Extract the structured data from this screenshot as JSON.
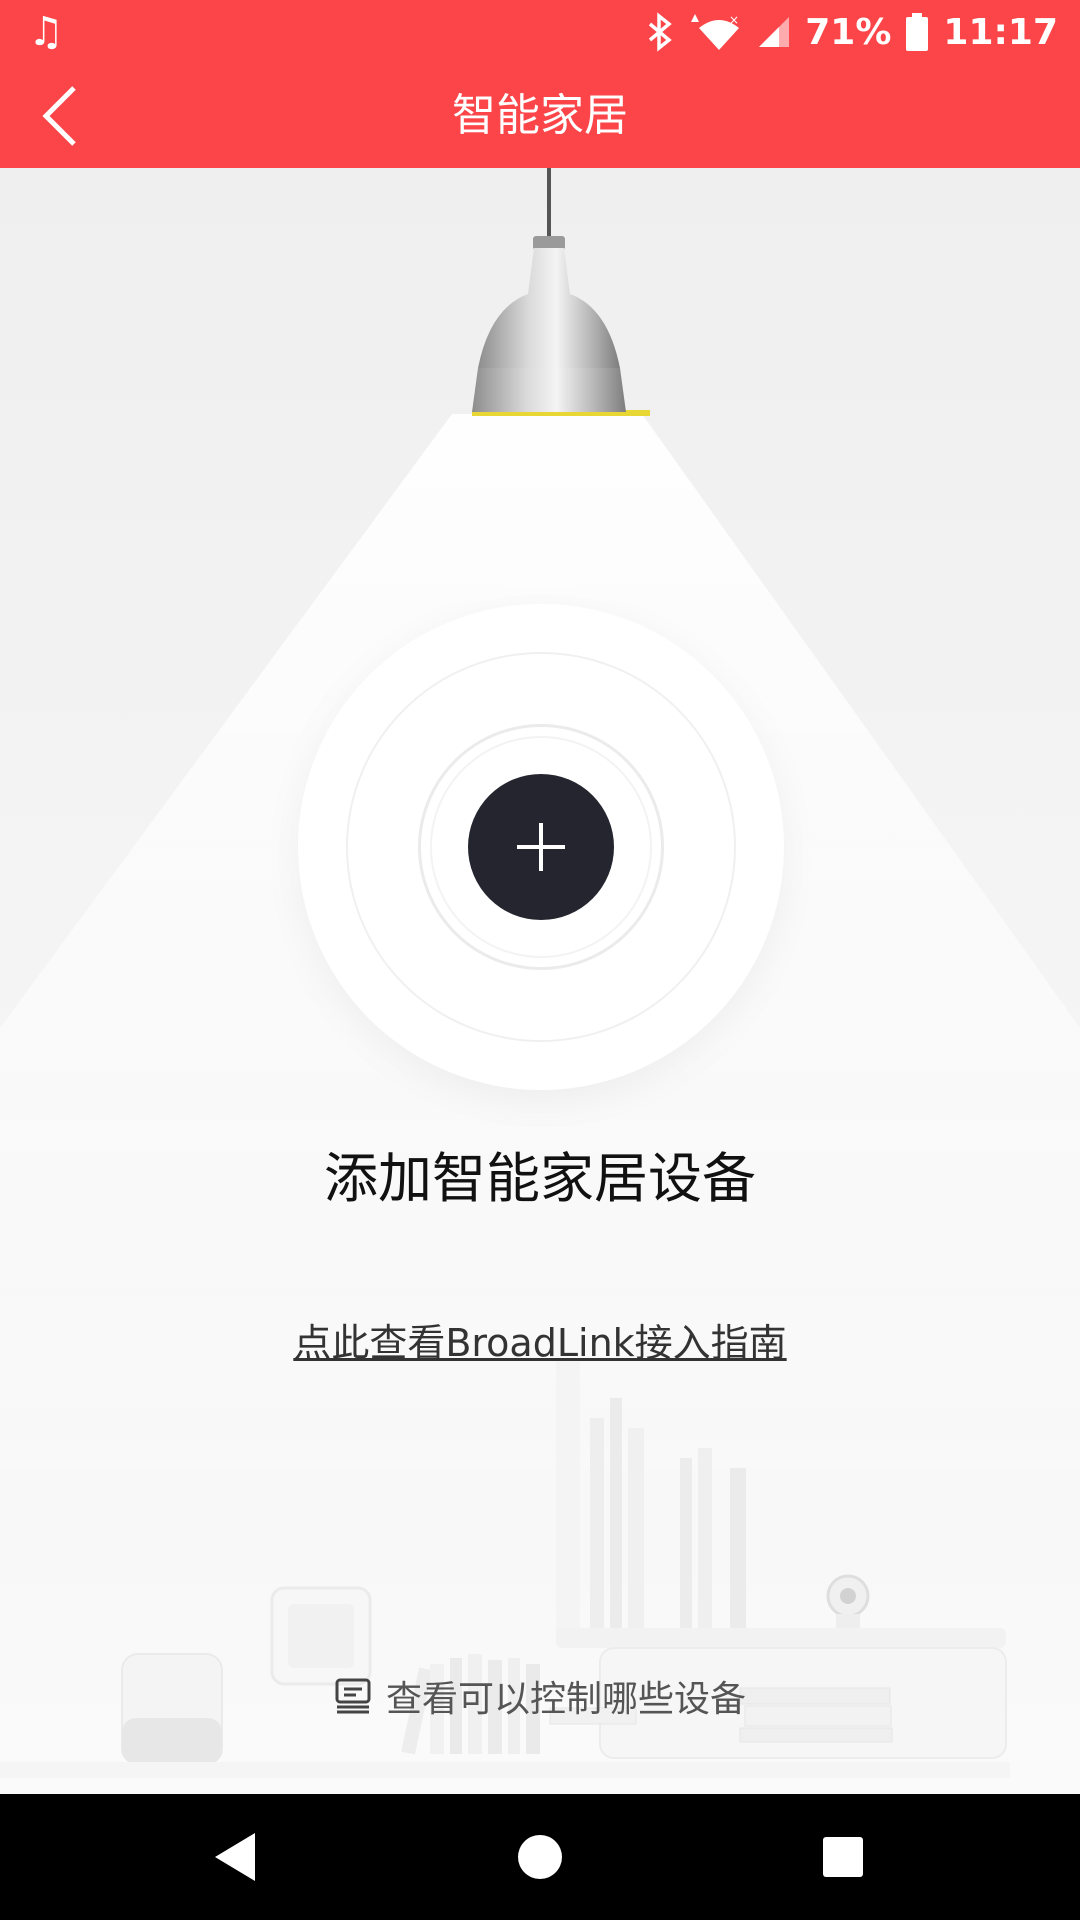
{
  "status_bar": {
    "music_icon": "music-note-icon",
    "battery_percent": "71%",
    "time": "11:17"
  },
  "header": {
    "title": "智能家居",
    "back_icon": "chevron-left-icon",
    "background_color": "#fb4549"
  },
  "main": {
    "add_button_icon": "plus-icon",
    "add_title": "添加智能家居设备",
    "guide_link": "点此查看BroadLink接入指南",
    "devices_link": {
      "icon": "device-list-icon",
      "label": "查看可以控制哪些设备"
    }
  },
  "nav_bar": {
    "back_icon": "triangle-back-icon",
    "home_icon": "circle-home-icon",
    "recents_icon": "square-recents-icon"
  }
}
